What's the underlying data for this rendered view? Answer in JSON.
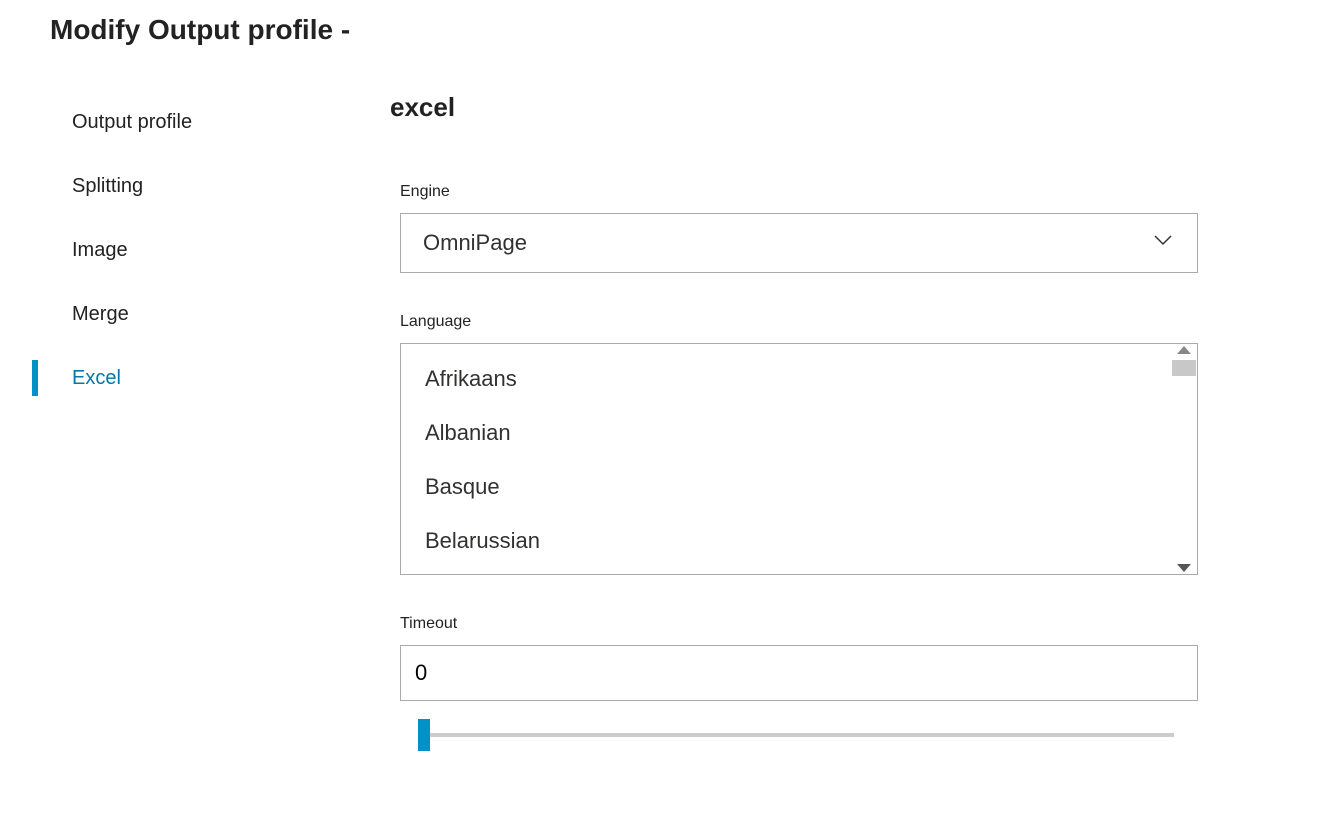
{
  "header": {
    "title": "Modify Output profile -"
  },
  "sidebar": {
    "items": [
      {
        "label": "Output profile",
        "active": false
      },
      {
        "label": "Splitting",
        "active": false
      },
      {
        "label": "Image",
        "active": false
      },
      {
        "label": "Merge",
        "active": false
      },
      {
        "label": "Excel",
        "active": true
      }
    ]
  },
  "main": {
    "section_title": "excel",
    "engine": {
      "label": "Engine",
      "value": "OmniPage"
    },
    "language": {
      "label": "Language",
      "options": [
        "Afrikaans",
        "Albanian",
        "Basque",
        "Belarussian"
      ]
    },
    "timeout": {
      "label": "Timeout",
      "value": "0"
    }
  }
}
